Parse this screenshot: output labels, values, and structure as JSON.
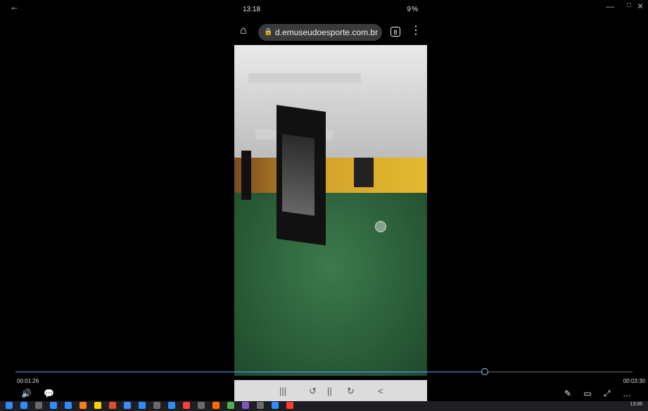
{
  "window": {
    "back_icon": "←",
    "min_icon": "—",
    "max_icon": "□",
    "close_icon": "✕"
  },
  "phone": {
    "status_time": "13:18",
    "status_icons": "9%"
  },
  "browser": {
    "url": "d.emuseudoesporte.com.br",
    "tabs_count": "8"
  },
  "video": {
    "time_elapsed": "00:01:26",
    "time_total": "00:03:30",
    "progress_fraction": 0.76
  },
  "icons": {
    "home": "⌂",
    "lock": "🔒",
    "menu": "⋮",
    "volume": "🔊",
    "captions": "💬",
    "edit": "✎",
    "miniplayer": "▭",
    "fullscreen": "⤢",
    "more": "…",
    "rewind": "↺",
    "pause": "||",
    "forward": "↻",
    "nav_back": "<",
    "nav_home": "○",
    "nav_recent": "|||"
  },
  "taskbar": {
    "time": "13:06",
    "colors": [
      "#2f8cff",
      "#2f8cff",
      "#6b6b6b",
      "#2f8cff",
      "#2f8cff",
      "#ff7a1a",
      "#ffd100",
      "#e04d2b",
      "#3c8cff",
      "#2f8cff",
      "#6b6b6b",
      "#2f8cff",
      "#ff3b3b",
      "#6b6b6b",
      "#ff6a00",
      "#4caf50",
      "#7e57c2",
      "#6b6b6b",
      "#2f8cff",
      "#ff3b30"
    ]
  }
}
